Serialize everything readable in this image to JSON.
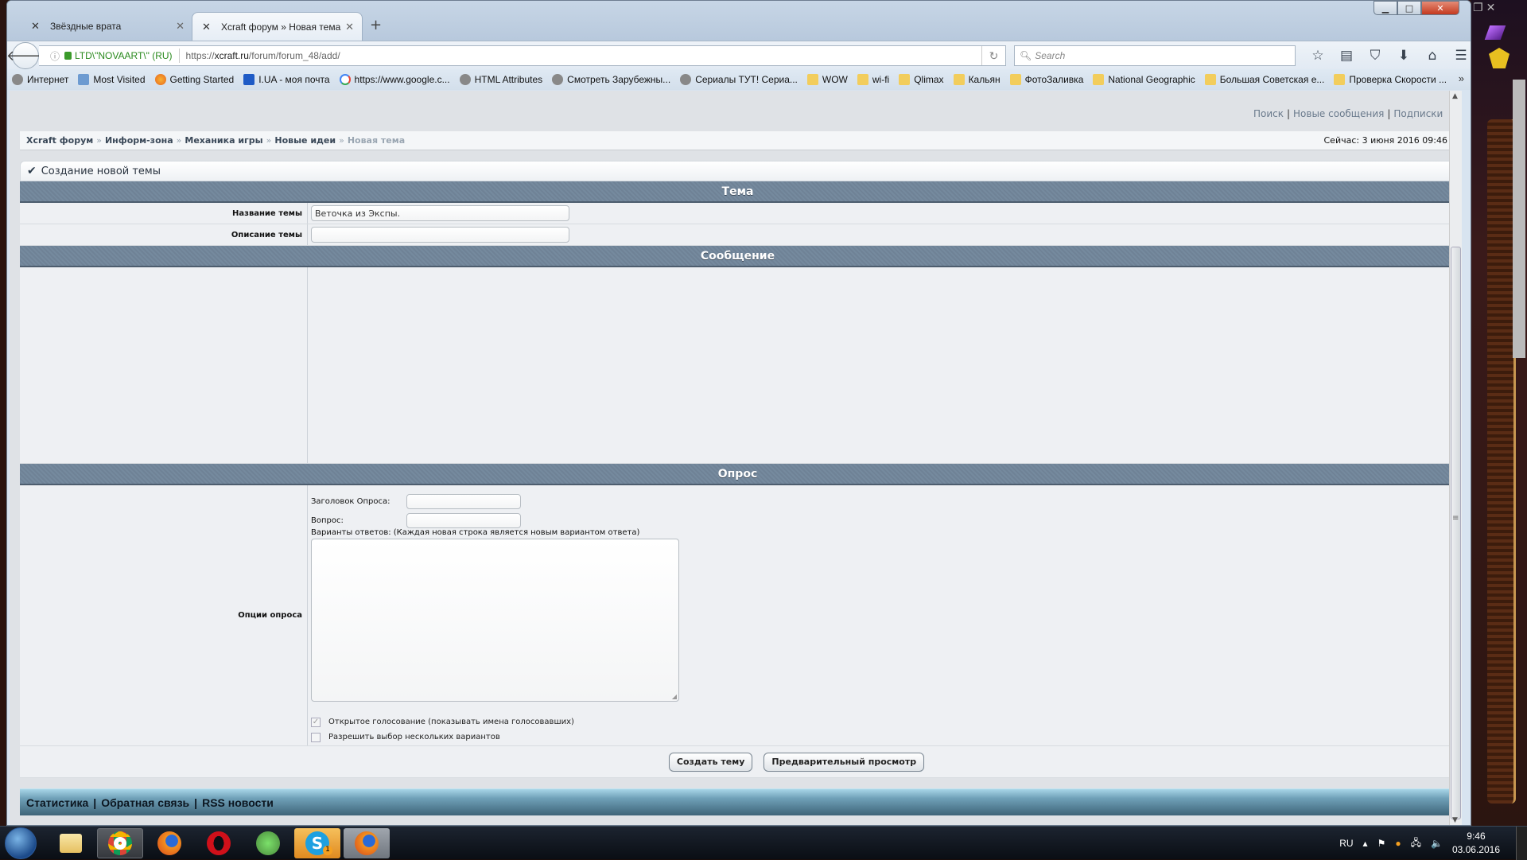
{
  "browser": {
    "tabs": [
      {
        "title": "Звёздные врата",
        "active": false
      },
      {
        "title": "Xcraft форум » Новая тема",
        "active": true
      }
    ],
    "address": {
      "identity": "LTD\\\"NOVAART\\\" (RU)",
      "url_prefix": "https://",
      "url_domain": "xcraft.ru",
      "url_path": "/forum/forum_48/add/"
    },
    "search_placeholder": "Search",
    "bookmarks": [
      {
        "label": "Интернет",
        "icon": "globe"
      },
      {
        "label": "Most Visited",
        "icon": "most-visited"
      },
      {
        "label": "Getting Started",
        "icon": "firefox"
      },
      {
        "label": "I.UA - моя почта",
        "icon": "iua"
      },
      {
        "label": "https://www.google.c...",
        "icon": "google"
      },
      {
        "label": "HTML Attributes",
        "icon": "globe"
      },
      {
        "label": "Смотреть Зарубежны...",
        "icon": "globe"
      },
      {
        "label": "Сериалы ТУТ! Сериа...",
        "icon": "globe"
      },
      {
        "label": "WOW",
        "icon": "folder"
      },
      {
        "label": "wi-fi",
        "icon": "folder"
      },
      {
        "label": "Qlimax",
        "icon": "folder"
      },
      {
        "label": "Кальян",
        "icon": "folder"
      },
      {
        "label": "ФотоЗаливка",
        "icon": "folder"
      },
      {
        "label": "National Geographic",
        "icon": "folder"
      },
      {
        "label": "Большая Советская е...",
        "icon": "folder"
      },
      {
        "label": "Проверка Скорости ...",
        "icon": "folder"
      }
    ]
  },
  "page": {
    "top_links": [
      "Поиск",
      "Новые сообщения",
      "Подписки"
    ],
    "breadcrumb": [
      "Xcraft форум",
      "Информ-зона",
      "Механика игры",
      "Новые идеи"
    ],
    "breadcrumb_current": "Новая тема",
    "now": "Сейчас: 3 июня 2016 09:46",
    "create_title": "Создание новой темы",
    "sections": {
      "topic": "Тема",
      "message": "Сообщение",
      "poll": "Опрос"
    },
    "topic_name_label": "Название темы",
    "topic_name_value": "Веточка из Экспы.",
    "topic_desc_label": "Описание темы",
    "topic_desc_value": "",
    "poll_options_label": "Опции опроса",
    "poll_title_label": "Заголовок Опроса:",
    "poll_question_label": "Вопрос:",
    "poll_answers_hint": "Варианты ответов: (Каждая новая строка является новым вариантом ответа)",
    "open_vote_label": "Открытое голосование (показывать имена голосовавших)",
    "open_vote_checked": true,
    "multi_choice_label": "Разрешить выбор нескольких вариантов",
    "multi_choice_checked": false,
    "submit_label": "Создать тему",
    "preview_label": "Предварительный просмотр",
    "footer_links": [
      "Статистика",
      "Обратная связь",
      "RSS новости"
    ]
  },
  "taskbar": {
    "apps": [
      "explorer",
      "chrome",
      "firefox",
      "opera",
      "tor-browser",
      "skype",
      "firefox-active"
    ],
    "skype_badge": "1",
    "language": "RU",
    "time": "9:46",
    "date": "03.06.2016"
  }
}
